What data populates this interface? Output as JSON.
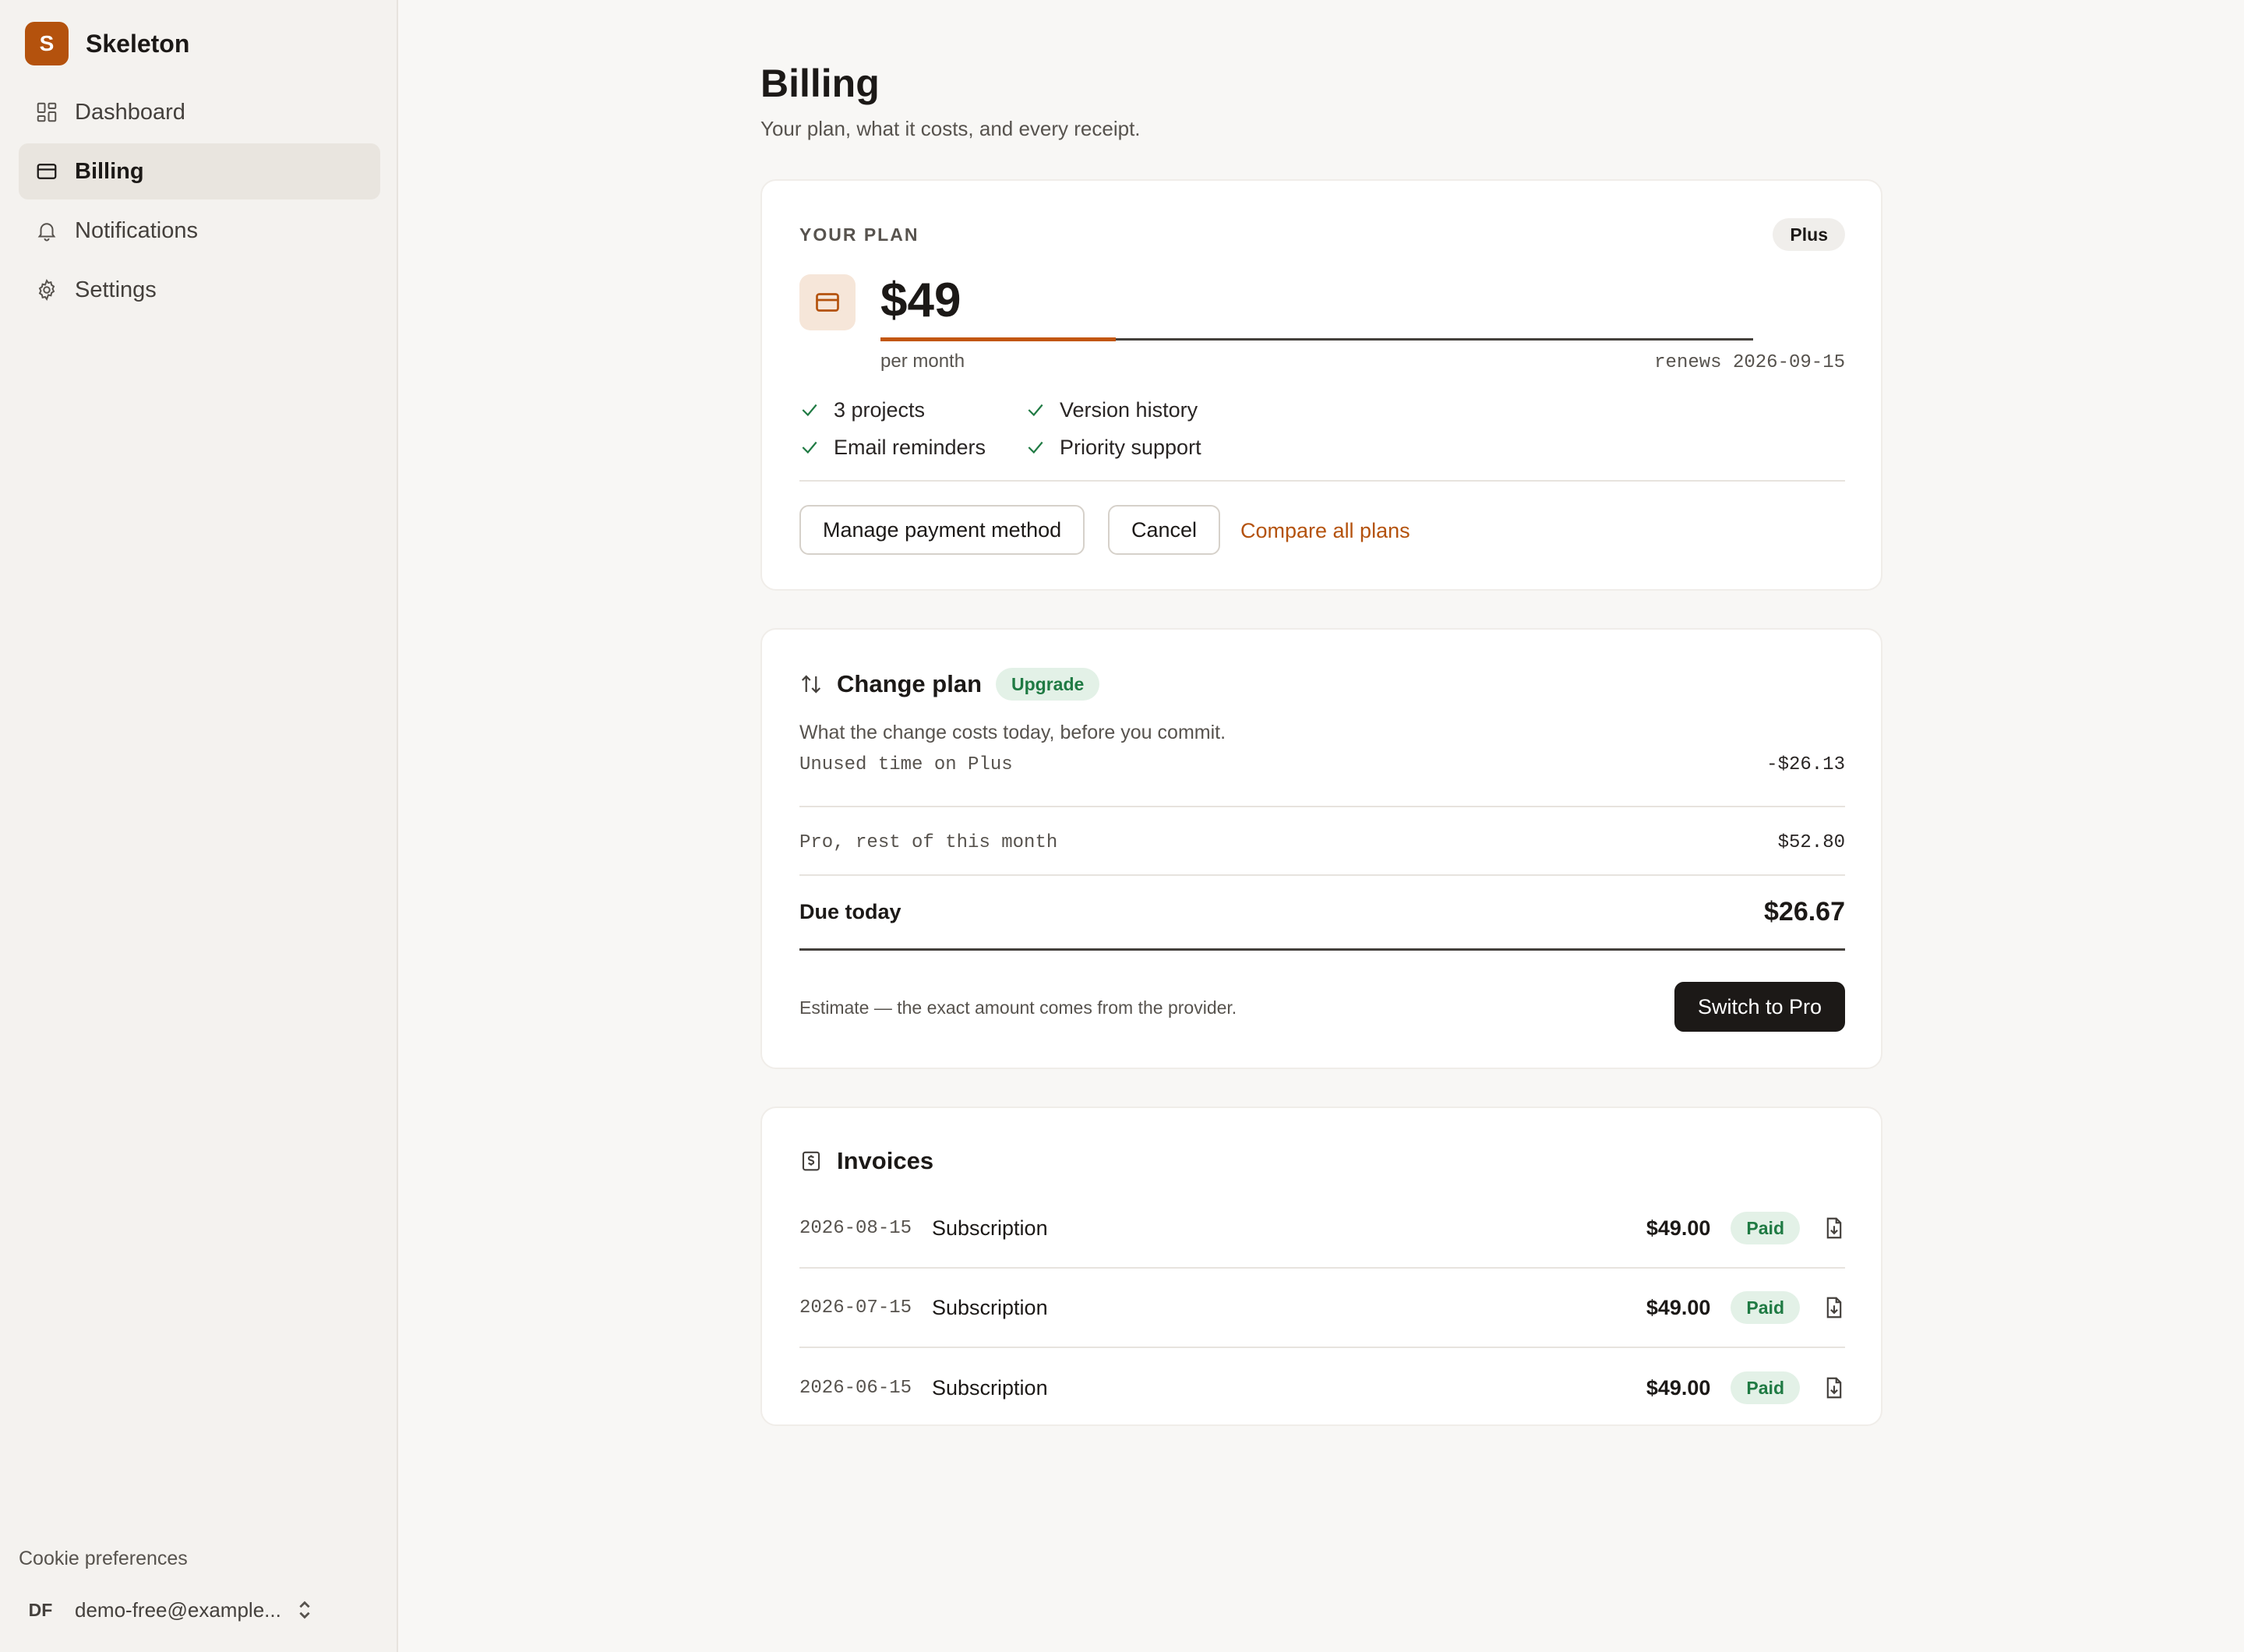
{
  "app": {
    "logo_letter": "S",
    "name": "Skeleton"
  },
  "sidebar": {
    "items": [
      {
        "label": "Dashboard",
        "icon": "dashboard-icon",
        "active": false
      },
      {
        "label": "Billing",
        "icon": "credit-card-icon",
        "active": true
      },
      {
        "label": "Notifications",
        "icon": "bell-icon",
        "active": false
      },
      {
        "label": "Settings",
        "icon": "gear-icon",
        "active": false
      }
    ],
    "cookie_label": "Cookie preferences",
    "account": {
      "initials": "DF",
      "email": "demo-free@example..."
    }
  },
  "page": {
    "title": "Billing",
    "subtitle": "Your plan, what it costs, and every receipt."
  },
  "plan": {
    "eyebrow": "YOUR PLAN",
    "badge": "Plus",
    "price": "$49",
    "period": "per month",
    "renews": "renews 2026-09-15",
    "cycle_progress": 0.27,
    "features": [
      "3 projects",
      "Version history",
      "Email reminders",
      "Priority support"
    ],
    "manage_label": "Manage payment method",
    "cancel_label": "Cancel",
    "compare_label": "Compare all plans"
  },
  "change_plan": {
    "title": "Change plan",
    "badge": "Upgrade",
    "description": "What the change costs today, before you commit.",
    "lines": [
      {
        "label": "Unused time on Plus",
        "amount": "-$26.13"
      },
      {
        "label": "Pro, rest of this month",
        "amount": "$52.80"
      }
    ],
    "due_label": "Due today",
    "due_amount": "$26.67",
    "estimate_note": "Estimate — the exact amount comes from the provider.",
    "switch_label": "Switch to Pro"
  },
  "invoices": {
    "title": "Invoices",
    "rows": [
      {
        "date": "2026-08-15",
        "description": "Subscription",
        "amount": "$49.00",
        "status": "Paid"
      },
      {
        "date": "2026-07-15",
        "description": "Subscription",
        "amount": "$49.00",
        "status": "Paid"
      },
      {
        "date": "2026-06-15",
        "description": "Subscription",
        "amount": "$49.00",
        "status": "Paid"
      }
    ]
  },
  "colors": {
    "accent": "#b4520d",
    "sidebar_bg": "#f4f2ef",
    "paid_bg": "#e3f1e7",
    "paid_text": "#1f7a43",
    "primary_button": "#1c1917"
  }
}
